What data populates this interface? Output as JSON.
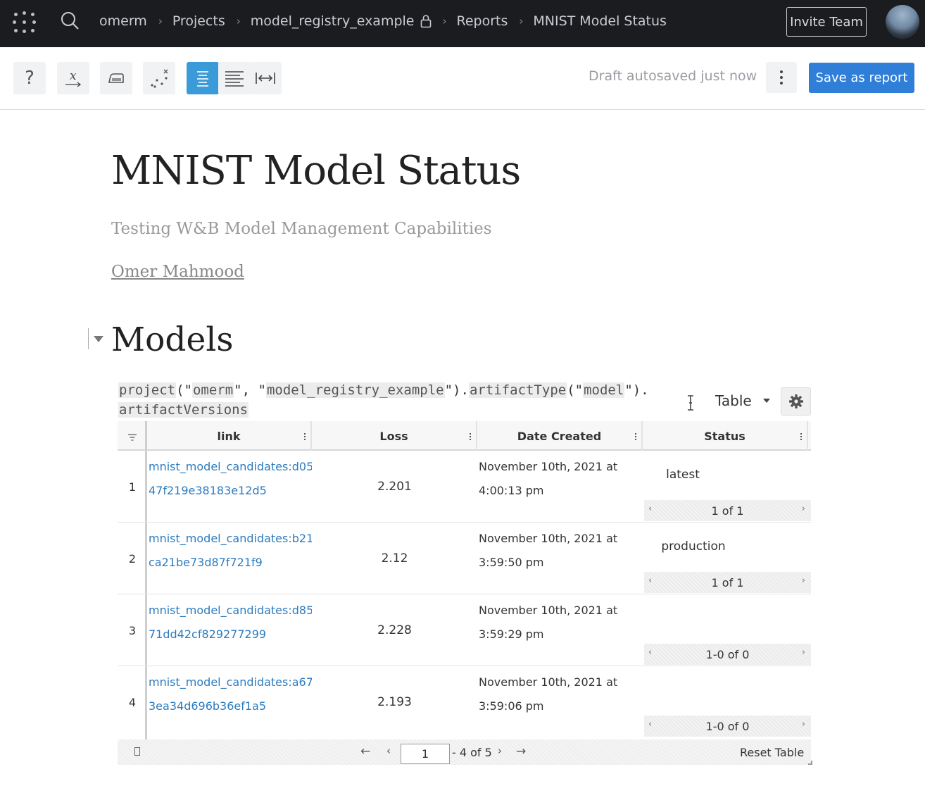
{
  "nav": {
    "breadcrumbs": [
      "omerm",
      "Projects",
      "model_registry_example",
      "Reports",
      "MNIST Model Status"
    ],
    "invite_label": "Invite Team"
  },
  "toolbar": {
    "draft_status": "Draft autosaved just now",
    "save_label": "Save as report",
    "help_glyph": "?",
    "formula_glyph": "x",
    "active_color": "#3b9bd8"
  },
  "report": {
    "title": "MNIST Model Status",
    "subtitle": "Testing W&B Model Management Capabilities",
    "author": "Omer Mahmood",
    "section_title": "Models"
  },
  "panel": {
    "query": {
      "t1": "project",
      "p1": "(\"",
      "a1": "omerm",
      "p2": "\", \"",
      "a2": "model_registry_example",
      "p3": "\").",
      "t2": "artifactType",
      "p4": "(\"",
      "a3": "model",
      "p5": "\").",
      "t3": "artifactVersions"
    },
    "type_label": "Table"
  },
  "table": {
    "columns": [
      "link",
      "Loss",
      "Date Created",
      "Status"
    ],
    "rows": [
      {
        "index": "1",
        "link_1": "mnist_model_candidates:d05",
        "link_2": "47f219e38183e12d5",
        "loss": "2.201",
        "date_1": "November 10th, 2021 at",
        "date_2": "4:00:13 pm",
        "status": "latest",
        "pager": "1 of 1"
      },
      {
        "index": "2",
        "link_1": "mnist_model_candidates:b21",
        "link_2": "ca21be73d87f721f9",
        "loss": "2.12",
        "date_1": "November 10th, 2021 at",
        "date_2": "3:59:50 pm",
        "status": "production",
        "pager": "1 of 1"
      },
      {
        "index": "3",
        "link_1": "mnist_model_candidates:d85",
        "link_2": "71dd42cf829277299",
        "loss": "2.228",
        "date_1": "November 10th, 2021 at",
        "date_2": "3:59:29 pm",
        "status": "",
        "pager": "1-0 of 0"
      },
      {
        "index": "4",
        "link_1": "mnist_model_candidates:a67",
        "link_2": "3ea34d696b36ef1a5",
        "loss": "2.193",
        "date_1": "November 10th, 2021 at",
        "date_2": "3:59:06 pm",
        "status": "",
        "pager": "1-0 of 0"
      }
    ],
    "footer": {
      "page_value": "1",
      "page_total": "- 4 of 5",
      "reset_label": "Reset Table"
    }
  }
}
